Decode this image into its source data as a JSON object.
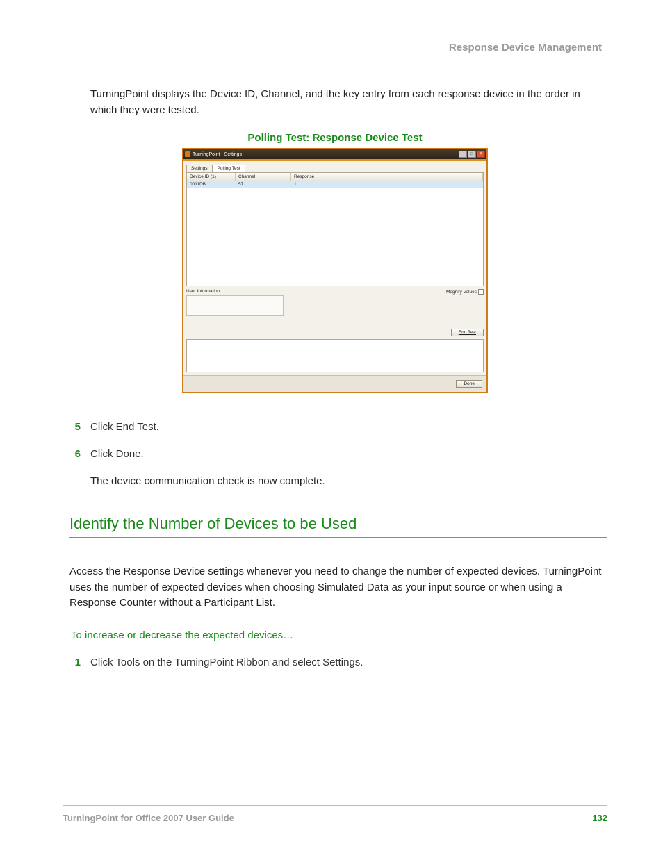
{
  "header": {
    "title": "Response Device Management"
  },
  "intro": "TurningPoint displays the Device ID, Channel, and the key entry from each response device in the order in which they were tested.",
  "caption": "Polling Test: Response Device Test",
  "window": {
    "title": "TurningPoint - Settings",
    "tabs": {
      "settings": "Settings",
      "polling": "Polling Test"
    },
    "columns": {
      "device": "Device ID (1)",
      "channel": "Channel",
      "response": "Response"
    },
    "row": {
      "device": "0011DB",
      "channel": "57",
      "response": "1"
    },
    "user_info_label": "User Information:",
    "magnify_label": "Magnify Values",
    "end_test": "End Test",
    "done": "Done"
  },
  "steps": {
    "s5": {
      "num": "5",
      "text": "Click End Test."
    },
    "s6": {
      "num": "6",
      "text": "Click Done."
    }
  },
  "complete_text": "The device communication check is now complete.",
  "section2": {
    "heading": "Identify the Number of Devices to be Used",
    "para": "Access the Response Device settings whenever you need to change the number of expected devices. TurningPoint uses the number of expected devices when choosing Simulated Data as your input source or when using a Response Counter without a Participant List.",
    "subhead": "To increase or decrease the expected devices…",
    "step1": {
      "num": "1",
      "text": "Click Tools on the TurningPoint Ribbon and select Settings."
    }
  },
  "footer": {
    "left": "TurningPoint for Office 2007 User Guide",
    "page": "132"
  }
}
